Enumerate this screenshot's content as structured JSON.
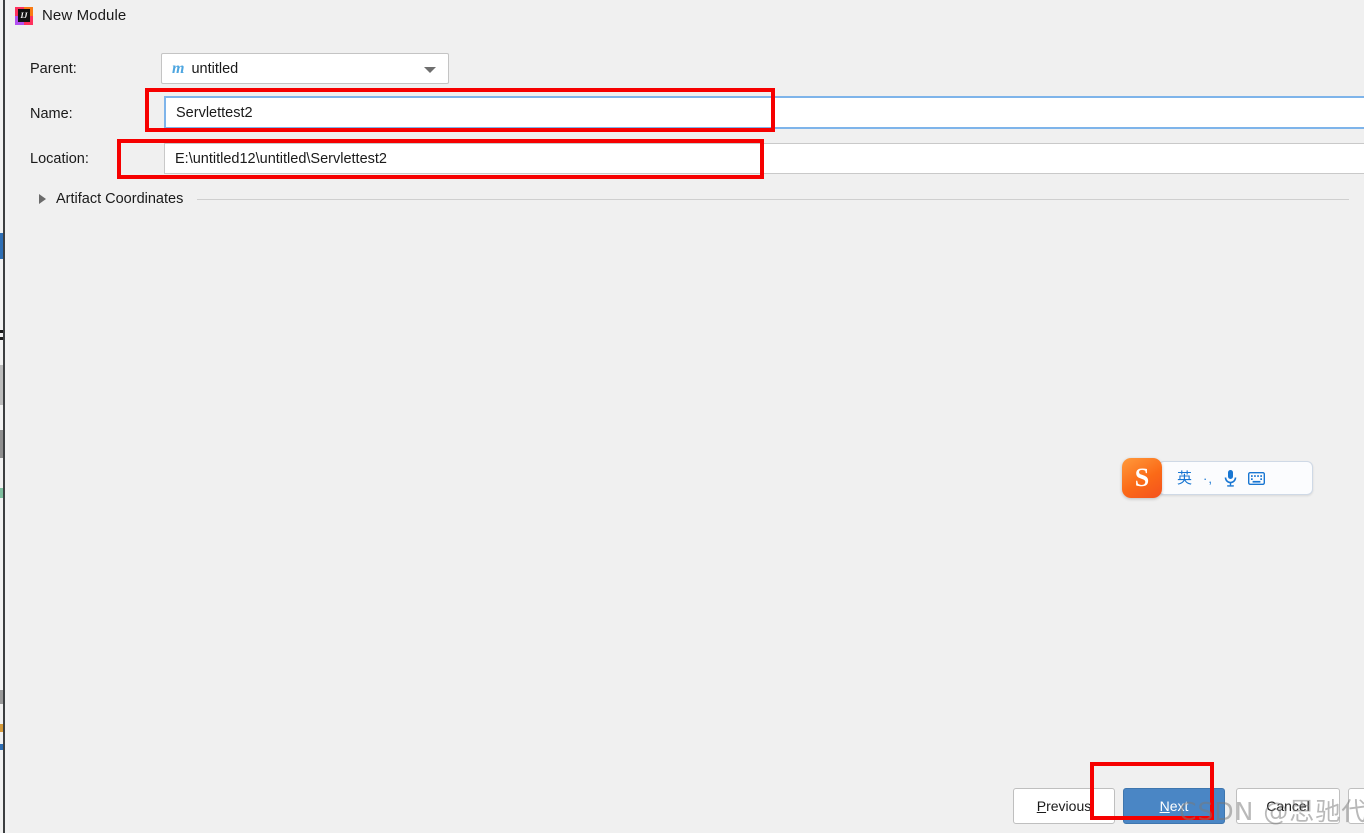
{
  "window": {
    "title": "New Module",
    "icon": "intellij-idea-icon"
  },
  "form": {
    "parent": {
      "label": "Parent:",
      "value": "untitled",
      "icon": "maven-module-icon",
      "dropdown_icon": "chevron-down-icon"
    },
    "name": {
      "label": "Name:",
      "value": "Servlettest2",
      "focused": true
    },
    "location": {
      "label": "Location:",
      "value": "E:\\untitled12\\untitled\\Servlettest2"
    },
    "artifact_coordinates": {
      "label": "Artifact Coordinates",
      "expanded": false,
      "toggle_icon": "chevron-right-icon"
    }
  },
  "buttons": {
    "previous": {
      "label": "Previous",
      "mnemonic": "P",
      "primary": false
    },
    "next": {
      "label": "Next",
      "mnemonic": "N",
      "primary": true
    },
    "cancel": {
      "label": "Cancel",
      "mnemonic": "C",
      "primary": false
    },
    "extra": {
      "label": "",
      "primary": false
    }
  },
  "annotations": {
    "color": "#f60000",
    "boxes": [
      "name-field",
      "location-field",
      "next-button"
    ]
  },
  "ime_toolbar": {
    "logo": "S",
    "logo_name": "sogou-logo",
    "items": [
      {
        "name": "language-mode-icon",
        "glyph": "英"
      },
      {
        "name": "punctuation-mode-icon",
        "glyph": "·,"
      },
      {
        "name": "microphone-icon",
        "glyph": "🎤"
      },
      {
        "name": "keyboard-icon",
        "glyph": "⌨"
      },
      {
        "name": "app-grid-icon",
        "glyph": ""
      }
    ]
  },
  "watermark": {
    "text": "CSDN @思驰代码块"
  },
  "colors": {
    "dialog_background": "#f0f0f0",
    "field_background": "#ffffff",
    "focus_border": "#7eb4ea",
    "primary_button": "#4a86c5",
    "annotation_red": "#f60000",
    "maven_icon": "#4ea6e0"
  }
}
